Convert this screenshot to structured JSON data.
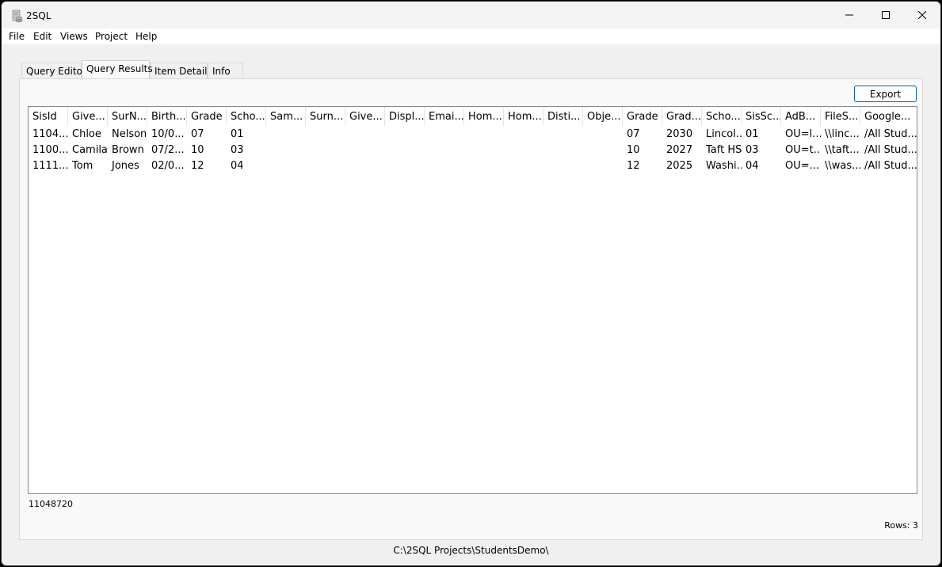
{
  "window": {
    "title": "2SQL",
    "icon": "database-scroll-icon",
    "controls": {
      "minimize": "minimize-icon",
      "maximize": "maximize-icon",
      "close": "close-icon"
    }
  },
  "menu": [
    "File",
    "Edit",
    "Views",
    "Project",
    "Help"
  ],
  "tabs": [
    {
      "label": "Query Editor",
      "active": false
    },
    {
      "label": "Query Results",
      "active": true
    },
    {
      "label": "Item Details",
      "active": false
    },
    {
      "label": "Info",
      "active": false
    }
  ],
  "toolbar": {
    "export_label": "Export"
  },
  "grid": {
    "columns": [
      "SisId",
      "Give...",
      "SurN...",
      "Birth...",
      "Grade",
      "Scho...",
      "Sam...",
      "Surn...",
      "Give...",
      "Displ...",
      "Emai...",
      "Hom...",
      "Hom...",
      "Disti...",
      "Obje...",
      "Grade",
      "Grad...",
      "Scho...",
      "SisSc...",
      "AdB...",
      "FileS...",
      "Google..."
    ],
    "rows": [
      [
        "1104...",
        "Chloe",
        "Nelson",
        "10/0...",
        "07",
        "01",
        "",
        "",
        "",
        "",
        "",
        "",
        "",
        "",
        "",
        "07",
        "2030",
        "Lincol...",
        "01",
        "OU=l...",
        "\\\\linc...",
        "/All Stud..."
      ],
      [
        "1100...",
        "Camila",
        "Brown",
        "07/2...",
        "10",
        "03",
        "",
        "",
        "",
        "",
        "",
        "",
        "",
        "",
        "",
        "10",
        "2027",
        "Taft HS",
        "03",
        "OU=t...",
        "\\\\taft...",
        "/All Stud..."
      ],
      [
        "1111...",
        "Tom",
        "Jones",
        "02/0...",
        "12",
        "04",
        "",
        "",
        "",
        "",
        "",
        "",
        "",
        "",
        "",
        "12",
        "2025",
        "Washi...",
        "04",
        "OU=...",
        "\\\\was...",
        "/All Stud..."
      ]
    ]
  },
  "status": {
    "selected_value": "11048720",
    "rows_label": "Rows: 3"
  },
  "footer": {
    "project_path": "C:\\2SQL Projects\\StudentsDemo\\"
  }
}
